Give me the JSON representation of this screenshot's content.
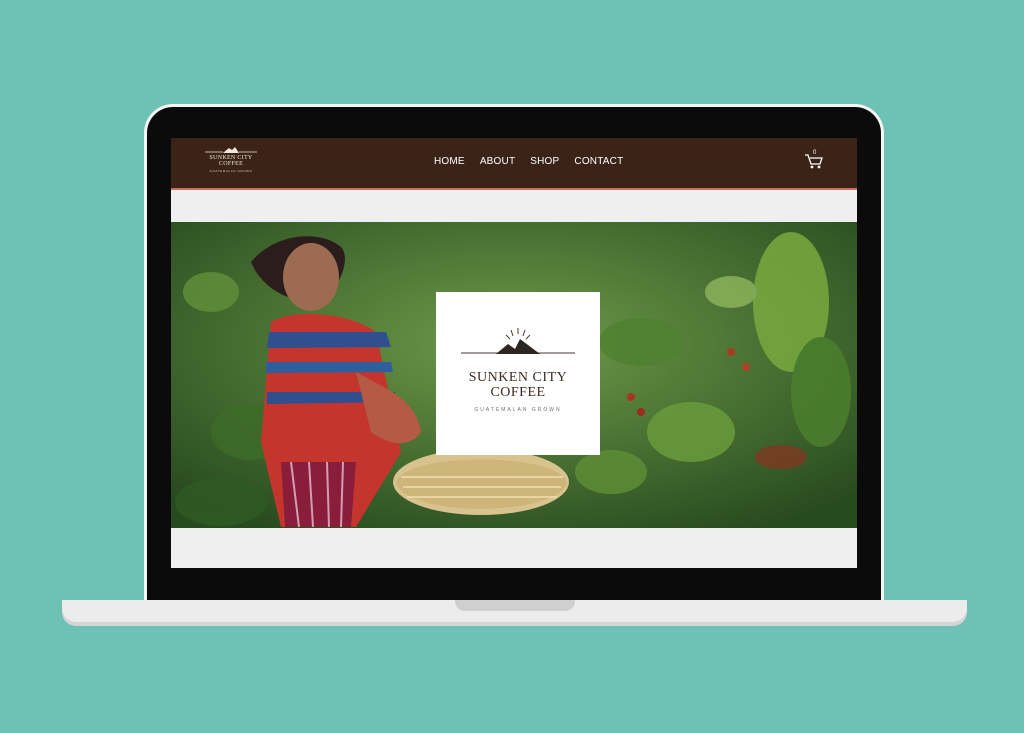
{
  "brand": {
    "line1": "SUNKEN CITY",
    "line2": "COFFEE",
    "tagline": "GUATEMALAN GROWN"
  },
  "nav": {
    "items": [
      "HOME",
      "ABOUT",
      "SHOP",
      "CONTACT"
    ]
  },
  "cart": {
    "count": "0"
  },
  "hero": {
    "logo_line1": "SUNKEN CITY",
    "logo_line2": "COFFEE",
    "logo_tagline": "GUATEMALAN GROWN"
  },
  "colors": {
    "background": "#6dc2b5",
    "topbar": "#3b2417",
    "accent": "#c8735a"
  }
}
